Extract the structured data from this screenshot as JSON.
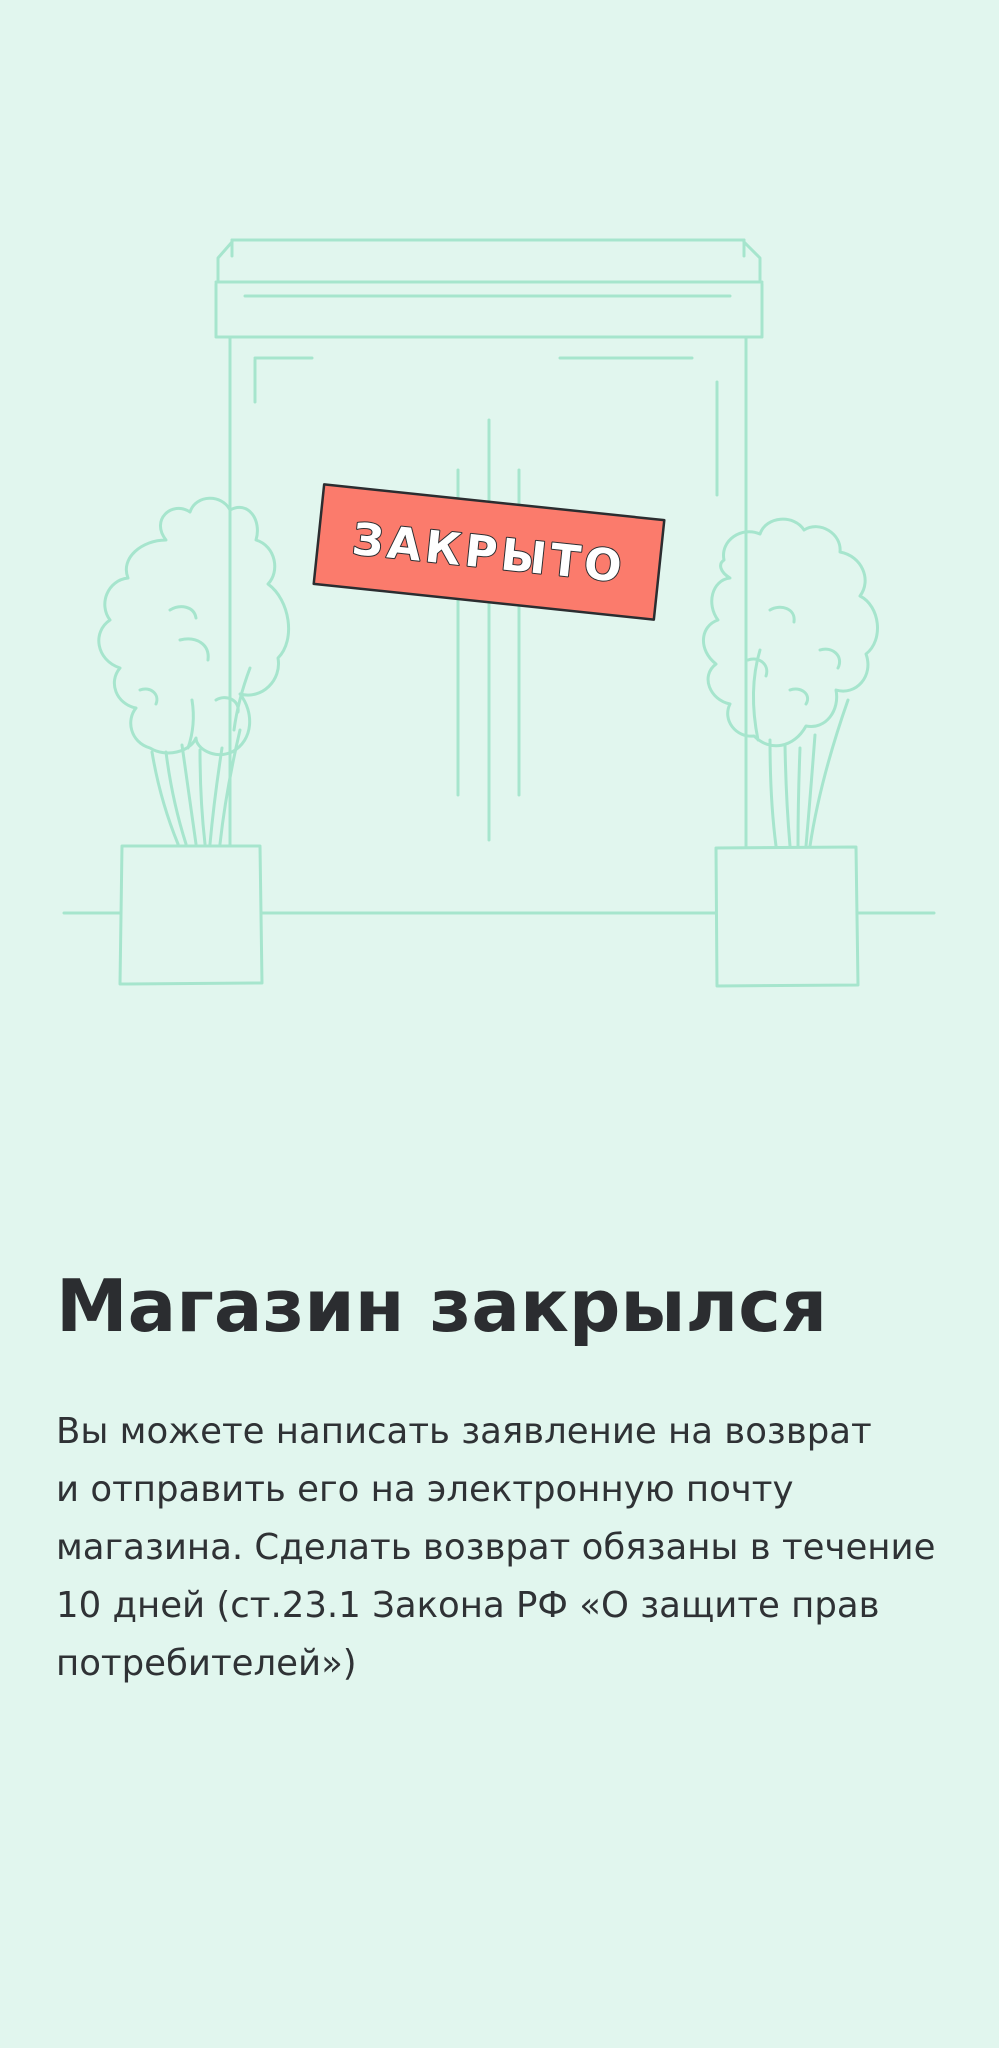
{
  "illustration": {
    "icon": "closed-store-illustration",
    "sign_text": "ЗАКРЫТО",
    "line_color": "#a6e5cd",
    "sign_color": "#fb7b6c"
  },
  "title": "Магазин закрылся",
  "description_lines": [
    "Вы можете написать заявление на возврат",
    "и отправить его на электронную почту",
    "магазина. Сделать возврат обязаны в течение",
    "10 дней (ст.23.1 Закона РФ «О защите прав",
    "потребителей»)"
  ],
  "colors": {
    "background": "#e1f6ee",
    "text": "#2b2d30"
  }
}
